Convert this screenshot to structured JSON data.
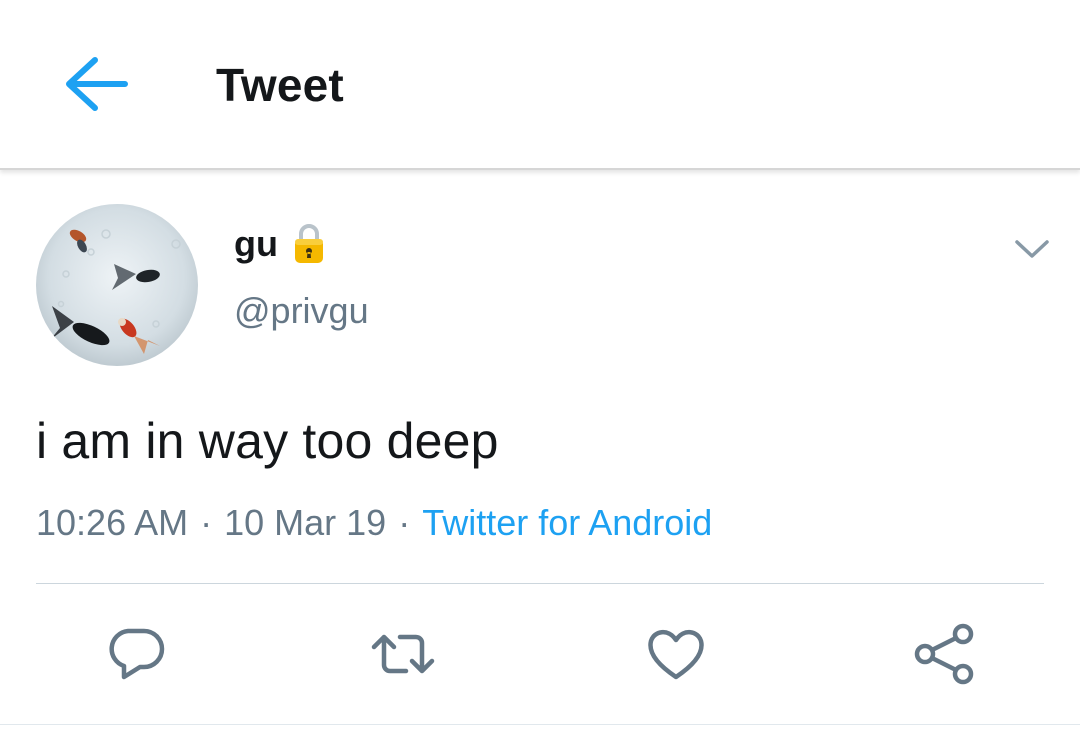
{
  "colors": {
    "accent": "#1da1f2",
    "text_primary": "#14171a",
    "text_secondary": "#657786",
    "lock_icon": "#f5b800"
  },
  "header": {
    "back_icon": "arrow-left-icon",
    "title": "Tweet"
  },
  "tweet": {
    "author": {
      "display_name": "gu",
      "handle": "@privgu",
      "protected_icon": "lock-icon",
      "avatar": "goldfish-avatar"
    },
    "menu_icon": "chevron-down-icon",
    "text": "i am in way too deep",
    "time": "10:26 AM",
    "separator": "·",
    "date": "10 Mar 19",
    "source": "Twitter for Android"
  },
  "actions": [
    {
      "name": "reply",
      "icon": "reply-icon"
    },
    {
      "name": "retweet",
      "icon": "retweet-icon"
    },
    {
      "name": "like",
      "icon": "heart-icon"
    },
    {
      "name": "share",
      "icon": "share-icon"
    }
  ]
}
